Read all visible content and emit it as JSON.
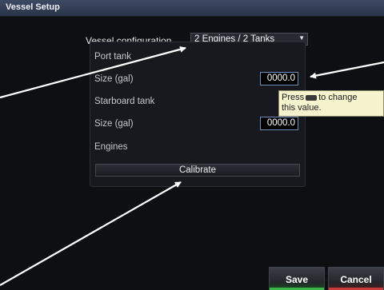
{
  "window": {
    "title": "Vessel Setup"
  },
  "vessel_configuration": {
    "label": "Vessel configuration",
    "value": "2 Engines / 2 Tanks"
  },
  "port_tank": {
    "heading": "Port tank",
    "size_label": "Size (gal)",
    "size_value": "0000.0"
  },
  "starboard_tank": {
    "heading": "Starboard tank",
    "size_label": "Size (gal)",
    "size_value": "0000.0"
  },
  "engines": {
    "heading": "Engines",
    "calibrate_label": "Calibrate"
  },
  "tooltip": {
    "text_before_icon": "Press",
    "text_after_icon": "to change",
    "line2": "this value."
  },
  "footer": {
    "save_label": "Save",
    "cancel_label": "Cancel"
  },
  "colors": {
    "save_accent": "#3ab646",
    "cancel_accent": "#c93a3a",
    "field_border": "#6d8eb7",
    "tooltip_bg": "#f6f4cf"
  }
}
